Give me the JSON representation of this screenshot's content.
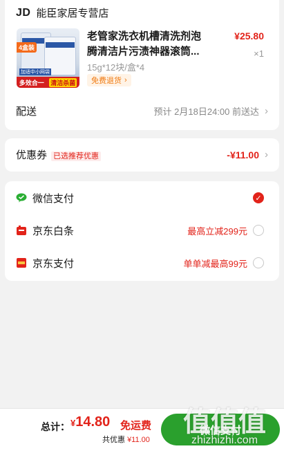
{
  "store": {
    "logo": "JD",
    "name": "能臣家居专营店"
  },
  "product": {
    "title_line1": "老管家洗衣机槽清洗剂泡",
    "title_line2": "腾清洁片污渍神器滚筒...",
    "price": "¥25.80",
    "quantity": "×1",
    "spec": "15g*12块/盒*4",
    "return_badge": "免费退货",
    "image": {
      "tag_top": "4盒装",
      "note": "加适中小网袋",
      "tag_bottom_left": "多效合一",
      "tag_bottom_right": "清洁杀菌"
    }
  },
  "delivery": {
    "label": "配送",
    "value": "预计 2月18日24:00 前送达"
  },
  "coupon": {
    "label": "优惠券",
    "tag": "已选推荐优惠",
    "value": "-¥11.00"
  },
  "payment": {
    "options": [
      {
        "label": "微信支付",
        "promo": "",
        "selected": true,
        "icon": "wechat-pay-icon",
        "color": "#2aae33"
      },
      {
        "label": "京东白条",
        "promo": "最高立减299元",
        "selected": false,
        "icon": "jd-baitiao-icon",
        "color": "#e2231a"
      },
      {
        "label": "京东支付",
        "promo": "单单减最高99元",
        "selected": false,
        "icon": "jd-pay-icon",
        "color": "#e2231a"
      }
    ]
  },
  "footer": {
    "total_label": "总计：",
    "currency": "¥",
    "total_value": "14.80",
    "free_shipping": "免运费",
    "discount_label": "共优惠",
    "discount_value": "¥11.00",
    "pay_button": "微信支付"
  },
  "watermark": {
    "chars": "值值值",
    "url": "zhizhizhi.com"
  },
  "colors": {
    "accent_red": "#e2231a",
    "wechat_green": "#2aa02d",
    "background": "#f2f2f2"
  }
}
